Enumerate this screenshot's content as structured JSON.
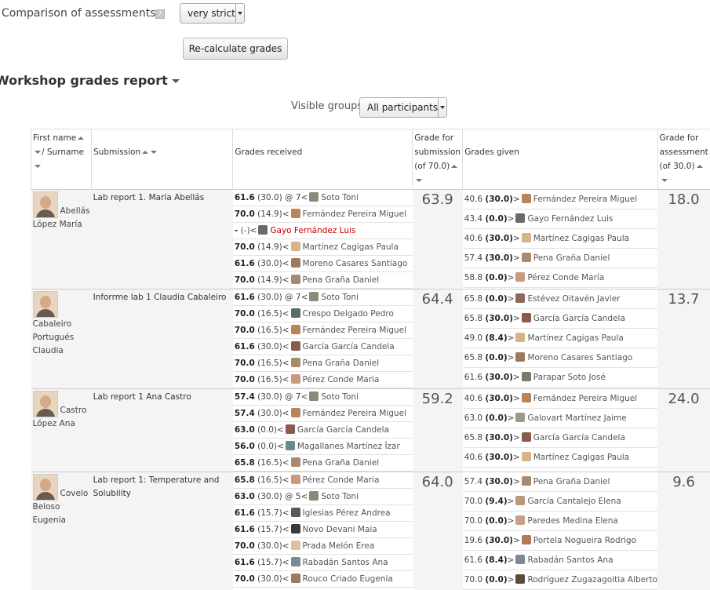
{
  "settings": {
    "comparison_label": "Comparison of assessments",
    "help_icon_glyph": "?",
    "comparison_value": "very strict",
    "recalc_label": "Re-calculate grades"
  },
  "report": {
    "title": "Workshop grades report",
    "visible_groups_label": "Visible groups",
    "visible_groups_value": "All participants"
  },
  "headers": {
    "first_name": "First name",
    "surname": "/ Surname",
    "submission": "Submission",
    "grades_received": "Grades received",
    "grade_for_submission": [
      "Grade for",
      "submission",
      "(of 70.0)"
    ],
    "grades_given": "Grades given",
    "grade_for_assessment": [
      "Grade for",
      "assessment",
      "(of 30.0)"
    ]
  },
  "students": [
    {
      "name_top": "Abellás",
      "name_rest": [
        "López María"
      ],
      "submission": "Lab report 1. María Abellás",
      "grade_for_submission": "63.9",
      "grade_for_assessment": "18.0",
      "received": [
        {
          "grade": "61.6",
          "weight": "(30.0) @ 7",
          "dir": "<",
          "name": "Soto Toni",
          "color": "#8a8a7a"
        },
        {
          "grade": "70.0",
          "weight": "(14.9)",
          "dir": "<",
          "name": "Fernández Pereira Miguel",
          "color": "#b8845c"
        },
        {
          "grade": "-",
          "weight": "(-)",
          "dir": "<",
          "name": "Gayo Fernández Luis",
          "color": "#6a6a6a",
          "red": true
        },
        {
          "grade": "70.0",
          "weight": "(14.9)",
          "dir": "<",
          "name": "Martínez Cagigas Paula",
          "color": "#d9b28a"
        },
        {
          "grade": "61.6",
          "weight": "(30.0)",
          "dir": "<",
          "name": "Moreno Casares Santiago",
          "color": "#9c7a5e"
        },
        {
          "grade": "70.0",
          "weight": "(14.9)",
          "dir": "<",
          "name": "Pena Graña Daniel",
          "color": "#a88a6e"
        }
      ],
      "given": [
        {
          "grade": "40.6",
          "weight": "(30.0)",
          "dir": ">",
          "name": "Fernández Pereira Miguel",
          "color": "#b8845c"
        },
        {
          "grade": "43.4",
          "weight": "(0.0)",
          "dir": ">",
          "name": "Gayo Fernández Luis",
          "color": "#6a6a6a"
        },
        {
          "grade": "40.6",
          "weight": "(30.0)",
          "dir": ">",
          "name": "Martínez Cagigas Paula",
          "color": "#d9b28a"
        },
        {
          "grade": "57.4",
          "weight": "(30.0)",
          "dir": ">",
          "name": "Pena Graña Daniel",
          "color": "#a88a6e"
        },
        {
          "grade": "58.8",
          "weight": "(0.0)",
          "dir": ">",
          "name": "Pérez Conde María",
          "color": "#c99a7e"
        }
      ]
    },
    {
      "name_top": "",
      "name_rest": [
        "Cabaleiro",
        "Portugués",
        "Claudia"
      ],
      "submission": "Inforrme lab 1 Claudia Cabaleiro",
      "grade_for_submission": "64.4",
      "grade_for_assessment": "13.7",
      "received": [
        {
          "grade": "61.6",
          "weight": "(30.0) @ 7",
          "dir": "<",
          "name": "Soto Toni",
          "color": "#8a8a7a"
        },
        {
          "grade": "70.0",
          "weight": "(16.5)",
          "dir": "<",
          "name": "Crespo Delgado Pedro",
          "color": "#5a6a6a"
        },
        {
          "grade": "70.0",
          "weight": "(16.5)",
          "dir": "<",
          "name": "Fernández Pereira Miguel",
          "color": "#b8845c"
        },
        {
          "grade": "61.6",
          "weight": "(30.0)",
          "dir": "<",
          "name": "García García Candela",
          "color": "#8a5a4a"
        },
        {
          "grade": "70.0",
          "weight": "(16.5)",
          "dir": "<",
          "name": "Pena Graña Daniel",
          "color": "#a88a6e"
        },
        {
          "grade": "70.0",
          "weight": "(16.5)",
          "dir": "<",
          "name": "Pérez Conde Maria",
          "color": "#c99a7e"
        }
      ],
      "given": [
        {
          "grade": "65.8",
          "weight": "(0.0)",
          "dir": ">",
          "name": "Estévez Oitavén Javier",
          "color": "#8a6a5a"
        },
        {
          "grade": "65.8",
          "weight": "(30.0)",
          "dir": ">",
          "name": "García García Candela",
          "color": "#8a5a4a"
        },
        {
          "grade": "49.0",
          "weight": "(8.4)",
          "dir": ">",
          "name": "Martínez Cagigas Paula",
          "color": "#d9b28a"
        },
        {
          "grade": "65.8",
          "weight": "(0.0)",
          "dir": ">",
          "name": "Moreno Casares Santiago",
          "color": "#9c7a5e"
        },
        {
          "grade": "61.6",
          "weight": "(30.0)",
          "dir": ">",
          "name": "Parapar Soto José",
          "color": "#7a7a6a"
        }
      ]
    },
    {
      "name_top": "Castro",
      "name_rest": [
        "López Ana"
      ],
      "submission": "Lab report 1 Ana Castro",
      "grade_for_submission": "59.2",
      "grade_for_assessment": "24.0",
      "received": [
        {
          "grade": "57.4",
          "weight": "(30.0) @ 7",
          "dir": "<",
          "name": "Soto Toni",
          "color": "#8a8a7a"
        },
        {
          "grade": "57.4",
          "weight": "(30.0)",
          "dir": "<",
          "name": "Fernández Pereira Miguel",
          "color": "#b8845c"
        },
        {
          "grade": "63.0",
          "weight": "(0.0)",
          "dir": "<",
          "name": "García García Candela",
          "color": "#8a5a4a"
        },
        {
          "grade": "56.0",
          "weight": "(0.0)",
          "dir": "<",
          "name": "Magallanes Martínez Ízar",
          "color": "#6a8a8a"
        },
        {
          "grade": "65.8",
          "weight": "(16.5)",
          "dir": "<",
          "name": "Pena Graña Daniel",
          "color": "#a88a6e"
        }
      ],
      "given": [
        {
          "grade": "40.6",
          "weight": "(30.0)",
          "dir": ">",
          "name": "Fernández Pereira Miguel",
          "color": "#b8845c"
        },
        {
          "grade": "63.0",
          "weight": "(0.0)",
          "dir": ">",
          "name": "Galovart Martínez Jaime",
          "color": "#9a9a8a"
        },
        {
          "grade": "65.8",
          "weight": "(30.0)",
          "dir": ">",
          "name": "García García Candela",
          "color": "#8a5a4a"
        },
        {
          "grade": "40.6",
          "weight": "(30.0)",
          "dir": ">",
          "name": "Martínez Cagigas Paula",
          "color": "#d9b28a"
        }
      ]
    },
    {
      "name_top": "Covelo",
      "name_rest": [
        "Beloso",
        "Eugenia"
      ],
      "submission": "Lab report 1: Temperature and Solubility",
      "grade_for_submission": "64.0",
      "grade_for_assessment": "9.6",
      "received": [
        {
          "grade": "65.8",
          "weight": "(16.5)",
          "dir": "<",
          "name": "Pérez Conde Maria",
          "color": "#c99a7e"
        },
        {
          "grade": "63.0",
          "weight": "(30.0) @ 5",
          "dir": "<",
          "name": "Soto Toni",
          "color": "#8a8a7a"
        },
        {
          "grade": "61.6",
          "weight": "(15.7)",
          "dir": "<",
          "name": "Iglesias Pérez Andrea",
          "color": "#5a5a5a"
        },
        {
          "grade": "61.6",
          "weight": "(15.7)",
          "dir": "<",
          "name": "Novo Devani Maia",
          "color": "#3a3a3a"
        },
        {
          "grade": "70.0",
          "weight": "(30.0)",
          "dir": "<",
          "name": "Prada Melón Erea",
          "color": "#e0c0a0"
        },
        {
          "grade": "61.6",
          "weight": "(15.7)",
          "dir": "<",
          "name": "Rabadán Santos Ana",
          "color": "#7a8a9a"
        },
        {
          "grade": "70.0",
          "weight": "(30.0)",
          "dir": "<",
          "name": "Rouco Criado Eugenia",
          "color": "#9a7a5a"
        }
      ],
      "given": [
        {
          "grade": "57.4",
          "weight": "(30.0)",
          "dir": ">",
          "name": "Pena Graña Daniel",
          "color": "#a88a6e"
        },
        {
          "grade": "70.0",
          "weight": "(9.4)",
          "dir": ">",
          "name": "García Cantalejo Elena",
          "color": "#b89a7a"
        },
        {
          "grade": "70.0",
          "weight": "(0.0)",
          "dir": ">",
          "name": "Paredes Medina Elena",
          "color": "#c8a08a"
        },
        {
          "grade": "19.6",
          "weight": "(30.0)",
          "dir": ">",
          "name": "Portela Nogueira Rodrigo",
          "color": "#b07a5a"
        },
        {
          "grade": "61.6",
          "weight": "(8.4)",
          "dir": ">",
          "name": "Rabadán Santos Ana",
          "color": "#7a8a9a"
        },
        {
          "grade": "70.0",
          "weight": "(0.0)",
          "dir": ">",
          "name": "Rodríguez Zugazagoitia Alberto",
          "color": "#5a4a3a"
        }
      ]
    }
  ]
}
